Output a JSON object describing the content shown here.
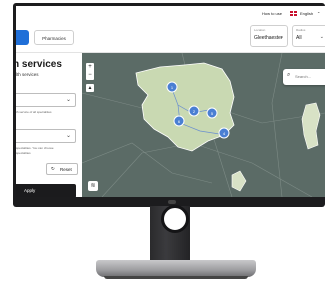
{
  "header": {
    "help_link": "How to use",
    "language": "English",
    "language_chevron": "⌄"
  },
  "tabs": {
    "pharmacies": "Pharmacies"
  },
  "filters": {
    "location": {
      "label": "Location",
      "value": "Gleethaester"
    },
    "radius": {
      "label": "Radius",
      "value": "All"
    }
  },
  "sidebar": {
    "title": "h services",
    "subtitle": "lth services",
    "note_1": "th service of all specialities",
    "note_2": "specialities. You can choose",
    "note_3": "specialities",
    "reset_label": "Reset",
    "reset_icon": "↻",
    "apply_label": "Apply"
  },
  "map": {
    "zoom_in": "+",
    "zoom_out": "−",
    "search_placeholder": "Search...",
    "search_icon": "⌕",
    "clusters": [
      {
        "count": "1"
      },
      {
        "count": "2"
      },
      {
        "count": "5"
      },
      {
        "count": "6"
      },
      {
        "count": "4"
      }
    ],
    "colors": {
      "region": "#c9d9b2",
      "cluster": "#4a7fd3",
      "base": "#5b6b66"
    }
  }
}
